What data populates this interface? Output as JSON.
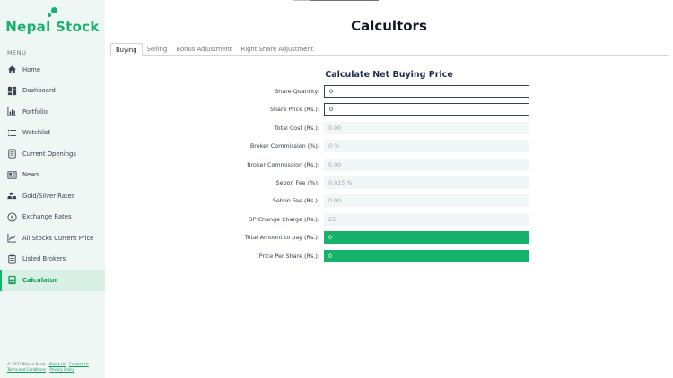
{
  "brand": {
    "name": "Nepal Stock",
    "color": "#16b26b"
  },
  "menu_label": "MENU",
  "nav": [
    {
      "label": "Home",
      "icon": "home-icon"
    },
    {
      "label": "Dashboard",
      "icon": "dashboard-icon"
    },
    {
      "label": "Portfolio",
      "icon": "bar-chart-icon"
    },
    {
      "label": "Watchlist",
      "icon": "list-icon"
    },
    {
      "label": "Current Openings",
      "icon": "document-icon"
    },
    {
      "label": "News",
      "icon": "newspaper-icon"
    },
    {
      "label": "Gold/Silver Rates",
      "icon": "gold-bars-icon"
    },
    {
      "label": "Exchange Rates",
      "icon": "dollar-circle-icon"
    },
    {
      "label": "All Stocks Current Price",
      "icon": "line-chart-icon"
    },
    {
      "label": "Listed Brokers",
      "icon": "clipboard-icon"
    },
    {
      "label": "Calculator",
      "icon": "calculator-icon",
      "active": true
    }
  ],
  "footer": {
    "copyright": "© 2021 Bhisan Basel",
    "links": [
      "About Us",
      "Contact Us",
      "Terms and Conditions",
      "Privacy Policy"
    ]
  },
  "page_title": "Calcultors",
  "tabs": [
    {
      "label": "Buying",
      "active": true
    },
    {
      "label": "Selling"
    },
    {
      "label": "Bonus Adjustment"
    },
    {
      "label": "Right Share Adjustment"
    }
  ],
  "form": {
    "title": "Calculate Net Buying Price",
    "fields": [
      {
        "label": "Share Quantity:",
        "value": "0",
        "kind": "editable"
      },
      {
        "label": "Share Price (Rs.):",
        "value": "0",
        "kind": "editable"
      },
      {
        "label": "Total Cost (Rs.):",
        "value": "0.00",
        "kind": "readonly"
      },
      {
        "label": "Broker Commission (%):",
        "value": "0 %",
        "kind": "readonly"
      },
      {
        "label": "Broker Commission (Rs.):",
        "value": "0.00",
        "kind": "readonly"
      },
      {
        "label": "Sebon Fee (%):",
        "value": "0.015 %",
        "kind": "readonly"
      },
      {
        "label": "Sebon Fee (Rs.):",
        "value": "0.00",
        "kind": "readonly"
      },
      {
        "label": "DP Change Charge (Rs.):",
        "value": "25",
        "kind": "readonly"
      },
      {
        "label": "Total Amount to pay (Rs.):",
        "value": "0",
        "kind": "total"
      },
      {
        "label": "Price Per Share (Rs.):",
        "value": "0",
        "kind": "total"
      }
    ]
  }
}
